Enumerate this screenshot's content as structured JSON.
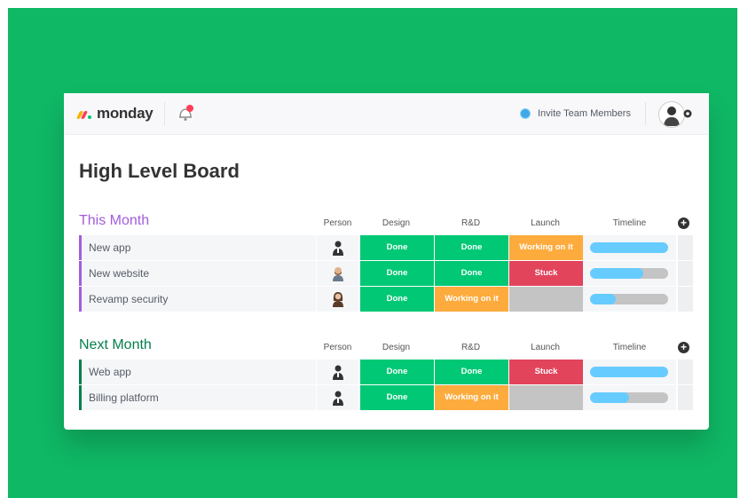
{
  "app": {
    "logo_text": "monday"
  },
  "header": {
    "invite_label": "Invite Team Members",
    "icons": [
      "notification-bell-icon",
      "user-avatar-icon",
      "gear-icon"
    ]
  },
  "board": {
    "title": "High Level Board"
  },
  "colors": {
    "background": "#0fb865",
    "done": "#00c875",
    "working": "#fdab3d",
    "stuck": "#e2445c",
    "empty": "#c4c4c4",
    "timeline_fill": "#66ccff",
    "group_this_month": "#a25ddc",
    "group_next_month": "#037f4c"
  },
  "groups": [
    {
      "title": "This Month",
      "color": "#a25ddc",
      "columns": {
        "person": "Person",
        "design": "Design",
        "rnd": "R&D",
        "launch": "Launch",
        "timeline": "Timeline",
        "add": "+"
      },
      "rows": [
        {
          "name": "New app",
          "avatar": "person-dark-icon",
          "design": "Done",
          "rnd": "Done",
          "launch": "Working on it",
          "timeline": 1.0
        },
        {
          "name": "New website",
          "avatar": "person-beard-icon",
          "design": "Done",
          "rnd": "Done",
          "launch": "Stuck",
          "timeline": 0.68
        },
        {
          "name": "Revamp security",
          "avatar": "person-hair-icon",
          "design": "Done",
          "rnd": "Working on it",
          "launch": "",
          "timeline": 0.33
        }
      ]
    },
    {
      "title": "Next Month",
      "color": "#037f4c",
      "columns": {
        "person": "Person",
        "design": "Design",
        "rnd": "R&D",
        "launch": "Launch",
        "timeline": "Timeline",
        "add": "+"
      },
      "rows": [
        {
          "name": "Web app",
          "avatar": "person-dark-icon",
          "design": "Done",
          "rnd": "Done",
          "launch": "Stuck",
          "timeline": 1.0
        },
        {
          "name": "Billing platform",
          "avatar": "person-dark-icon",
          "design": "Done",
          "rnd": "Working on it",
          "launch": "",
          "timeline": 0.5
        }
      ]
    }
  ]
}
